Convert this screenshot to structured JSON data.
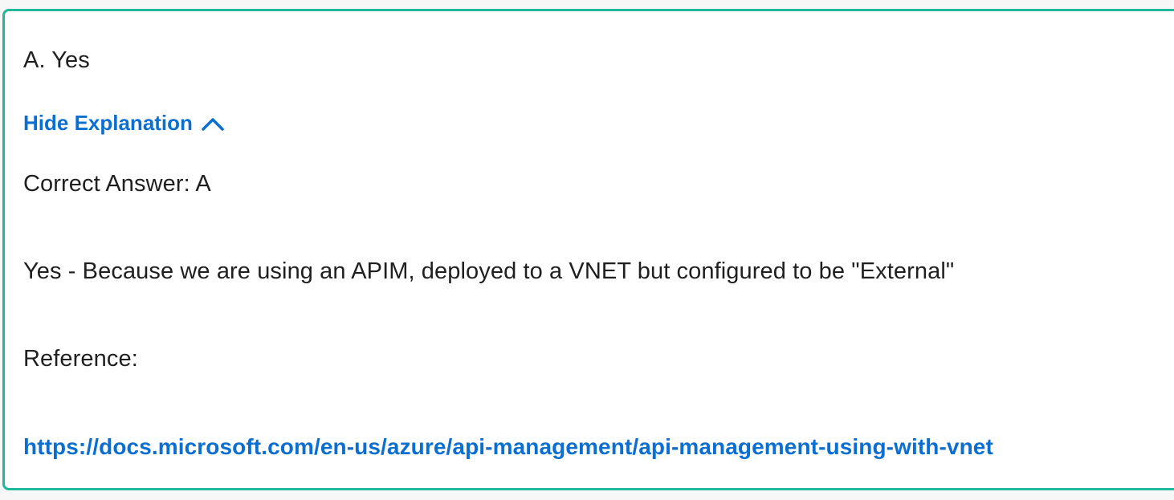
{
  "answer": {
    "option_text": "A. Yes"
  },
  "explanation_toggle": {
    "label": "Hide Explanation",
    "icon": "chevron-up-icon"
  },
  "explanation": {
    "correct_answer": "Correct Answer: A",
    "body": "Yes - Because we are using an APIM, deployed to a VNET but configured to be \"External\"",
    "reference_label": "Reference:",
    "reference_url": "https://docs.microsoft.com/en-us/azure/api-management/api-management-using-with-vnet"
  },
  "colors": {
    "border": "#1fb89a",
    "link": "#0b6ed1",
    "text": "#1f1f1f"
  }
}
